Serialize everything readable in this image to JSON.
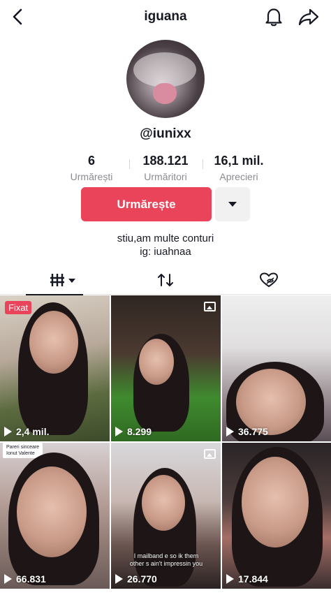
{
  "header": {
    "title": "iguana"
  },
  "profile": {
    "handle": "@iunixx",
    "stats": [
      {
        "value": "6",
        "label": "Urmărești"
      },
      {
        "value": "188.121",
        "label": "Urmăritori"
      },
      {
        "value": "16,1 mil.",
        "label": "Aprecieri"
      }
    ],
    "follow_label": "Urmărește",
    "bio_line1": "stiu,am multe conturi",
    "bio_line2": "ig: iuahnaa"
  },
  "videos": [
    {
      "views": "2,4 mil.",
      "badge": "Fixat"
    },
    {
      "views": "8.299"
    },
    {
      "views": "36.775"
    },
    {
      "views": "66.831",
      "sticker": "Pareri sinceare\nIonut Valente"
    },
    {
      "views": "26.770",
      "caption": "I mailband e so ik them other s ain't impressin you"
    },
    {
      "views": "17.844"
    }
  ],
  "colors": {
    "accent": "#ea445a",
    "text": "#161823",
    "muted": "#8a8b91"
  }
}
